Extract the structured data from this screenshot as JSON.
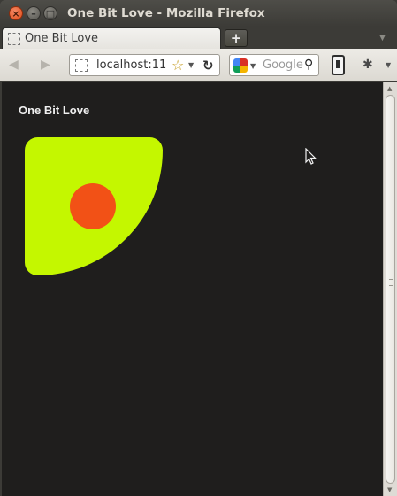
{
  "window": {
    "title": "One Bit Love - Mozilla Firefox",
    "close_glyph": "×",
    "min_glyph": "–",
    "max_glyph": "□"
  },
  "tabs": [
    {
      "label": "One Bit Love",
      "active": true
    }
  ],
  "tabstrip": {
    "new_tab_glyph": "+",
    "list_glyph": "▼"
  },
  "navbar": {
    "back_glyph": "◀",
    "forward_glyph": "▶",
    "url": "localhost:11",
    "star_glyph": "☆",
    "drop_glyph": "▼",
    "reload_glyph": "↻",
    "search_placeholder": "Google",
    "search_go_glyph": "⚲",
    "bug_glyph": "✱"
  },
  "page": {
    "heading": "One Bit Love",
    "logo_colors": {
      "shape": "#c4f700",
      "dot": "#f25116"
    },
    "background": "#1f1e1d"
  },
  "scrollbar": {
    "up_glyph": "▲",
    "down_glyph": "▼"
  }
}
